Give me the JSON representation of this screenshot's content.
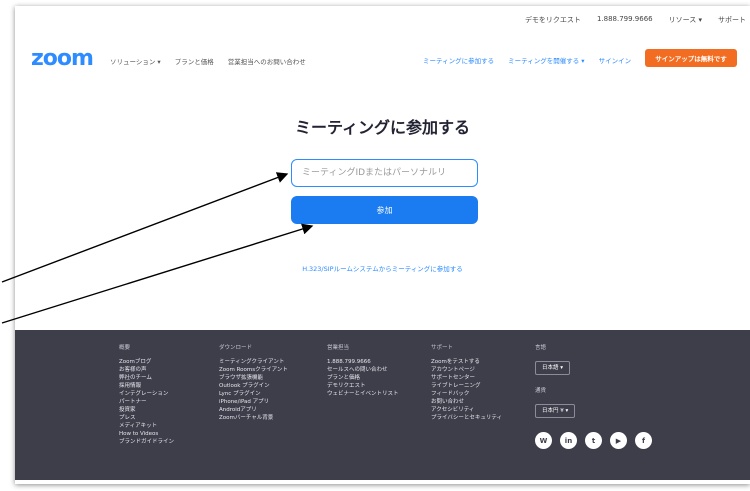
{
  "topbar": {
    "links": [
      "デモをリクエスト",
      "1.888.799.9666",
      "リソース ▾",
      "サポート"
    ]
  },
  "nav": {
    "logo": "zoom",
    "left_items": [
      "ソリューション ▾",
      "プランと価格",
      "営業担当へのお問い合わせ"
    ],
    "right_items": [
      "ミーティングに参加する",
      "ミーティングを開催する ▾",
      "サインイン"
    ],
    "signup": "サインアップは無料です"
  },
  "main": {
    "title": "ミーティングに参加する",
    "input_placeholder": "ミーティングIDまたはパーソナルリ",
    "join_button": "参加",
    "h323_link": "H.323/SIPルームシステムからミーティングに参加する"
  },
  "footer": {
    "about": {
      "heading": "概要",
      "items": [
        "Zoomブログ",
        "お客様の声",
        "弊社のチーム",
        "採用情報",
        "インテグレーション",
        "パートナー",
        "投資家",
        "プレス",
        "メディアキット",
        "How to Videos",
        "ブランドガイドライン"
      ]
    },
    "download": {
      "heading": "ダウンロード",
      "items": [
        "ミーティングクライアント",
        "Zoom Roomsクライアント",
        "ブラウザ拡張機能",
        "Outlook プラグイン",
        "Lync プラグイン",
        "iPhone/iPad アプリ",
        "Androidアプリ",
        "Zoomバーチャル背景"
      ]
    },
    "sales": {
      "heading": "営業担当",
      "items": [
        "1.888.799.9666",
        "セールスへの問い合わせ",
        "プランと価格",
        "デモリクエスト",
        "ウェビナーとイベントリスト"
      ]
    },
    "support": {
      "heading": "サポート",
      "items": [
        "Zoomをテストする",
        "アカウントページ",
        "サポートセンター",
        "ライブトレーニング",
        "フィードバック",
        "お問い合わせ",
        "アクセシビリティ",
        "プライバシーとセキュリティ"
      ]
    },
    "language": {
      "heading": "言語",
      "value": "日本語 ▾"
    },
    "currency": {
      "heading": "通貨",
      "value": "日本円 ¥ ▾"
    },
    "social": [
      "W",
      "in",
      "t",
      "▶",
      "f"
    ]
  },
  "colors": {
    "brand": "#2d8cff",
    "signup": "#f26d21",
    "footer": "#3e3e4b",
    "join": "#1a7cf0"
  }
}
